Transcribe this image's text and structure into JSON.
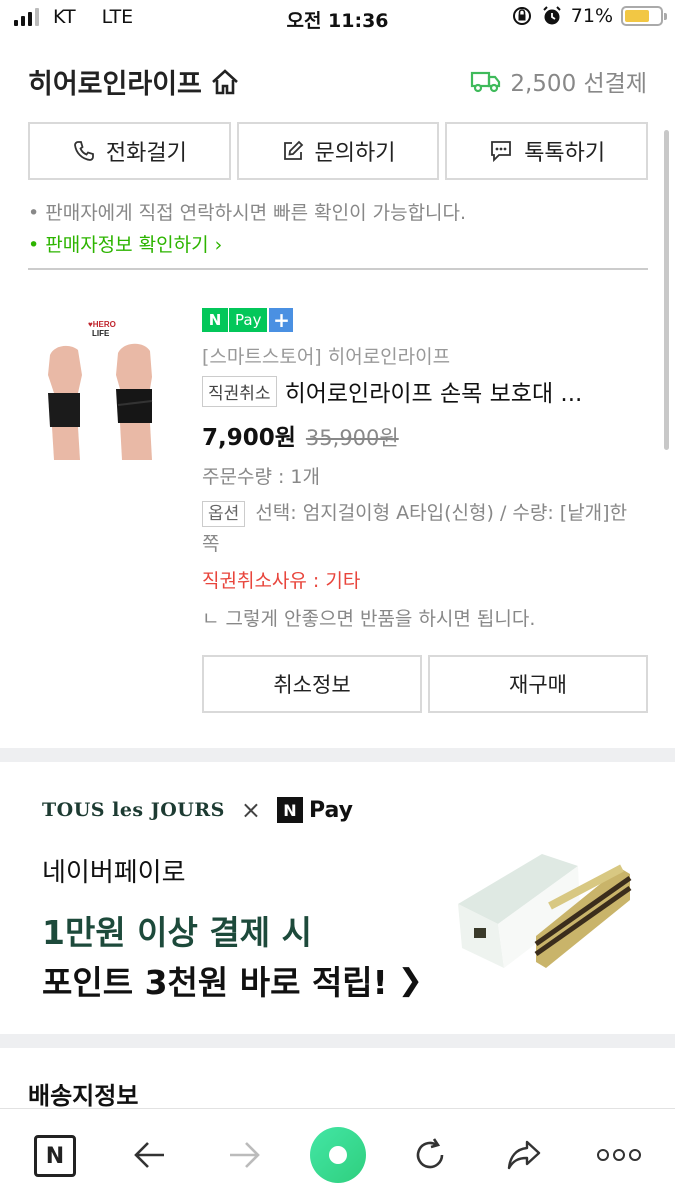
{
  "status_bar": {
    "carrier": "KT",
    "network": "LTE",
    "time": "오전 11:36",
    "battery": "71%",
    "battery_level": 0.71
  },
  "seller": {
    "name": "히어로인라이프",
    "shipping_fee": "2,500 선결제",
    "contact_buttons": {
      "call": "전화걸기",
      "inquiry": "문의하기",
      "talk": "톡톡하기"
    },
    "notice": "• 판매자에게 직접 연락하시면 빠른 확인이 가능합니다.",
    "info_link": "• 판매자정보 확인하기"
  },
  "order": {
    "pay_badge": {
      "n": "N",
      "pay": "Pay",
      "plus": "+"
    },
    "store": "[스마트스토어] 히어로인라이프",
    "status_tag": "직권취소",
    "product_name": "히어로인라이프 손목 보호대 ...",
    "price": "7,900원",
    "original_price": "35,900원",
    "quantity": "주문수량 : 1개",
    "option_tag": "옵션",
    "option_text": "선택: 엄지걸이형 A타입(신형) / 수량: [낱개]한쪽",
    "cancel_reason": "직권취소사유 : 기타",
    "cancel_note": "ㄴ 그렇게 안좋으면 반품을 하시면 됩니다.",
    "buttons": {
      "cancel_info": "취소정보",
      "rebuy": "재구매"
    },
    "image_logo_text": "HERO LIFE"
  },
  "banner": {
    "brand_text": "TOUS les JOURS",
    "times": "×",
    "npay_n": "N",
    "npay_text": "Pay",
    "subtitle": "네이버페이로",
    "headline_1": "1만원 이상 결제 시",
    "headline_2": "포인트 3천원 바로 적립!",
    "arrow": "❯"
  },
  "shipping_section": {
    "title": "배송지정보"
  },
  "toolbar": {
    "home_label": "N"
  },
  "colors": {
    "accent_green": "#2db400",
    "pay_green": "#03c75a",
    "cancel_red": "#e8453c",
    "banner_green": "#1d4a3b"
  }
}
